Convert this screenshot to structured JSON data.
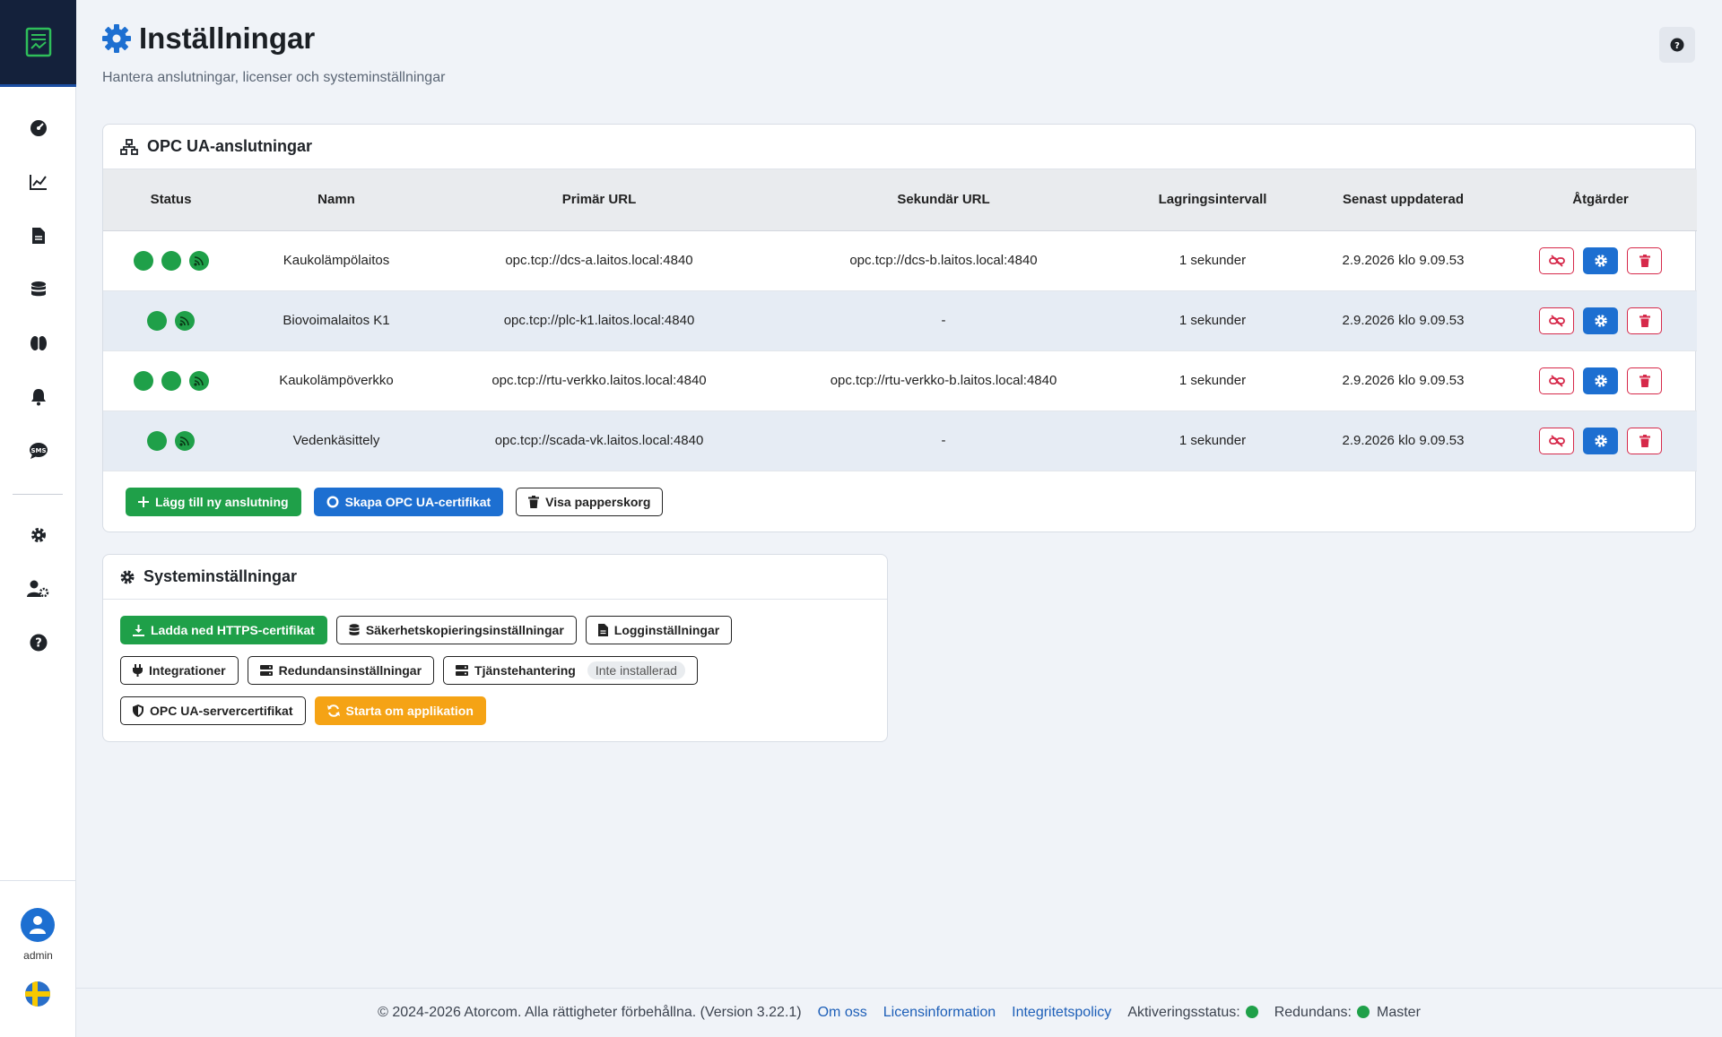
{
  "header": {
    "title": "Inställningar",
    "subtitle": "Hantera anslutningar, licenser och systeminställningar"
  },
  "sidebar": {
    "items": [
      {
        "icon": "dashboard-icon"
      },
      {
        "icon": "chart-icon"
      },
      {
        "icon": "document-icon"
      },
      {
        "icon": "database-icon"
      },
      {
        "icon": "brain-icon"
      },
      {
        "icon": "bell-icon"
      },
      {
        "icon": "sms-icon"
      },
      {
        "icon": "gear-icon"
      },
      {
        "icon": "user-settings-icon"
      },
      {
        "icon": "help-icon"
      }
    ],
    "user": "admin"
  },
  "opc": {
    "title": "OPC UA-anslutningar",
    "columns": [
      "Status",
      "Namn",
      "Primär URL",
      "Sekundär URL",
      "Lagringsintervall",
      "Senast uppdaterad",
      "Åtgärder"
    ],
    "rows": [
      {
        "status_dots": 2,
        "name": "Kaukolämpölaitos",
        "primary": "opc.tcp://dcs-a.laitos.local:4840",
        "secondary": "opc.tcp://dcs-b.laitos.local:4840",
        "interval": "1 sekunder",
        "updated": "2.9.2026 klo 9.09.53"
      },
      {
        "status_dots": 1,
        "name": "Biovoimalaitos K1",
        "primary": "opc.tcp://plc-k1.laitos.local:4840",
        "secondary": "-",
        "interval": "1 sekunder",
        "updated": "2.9.2026 klo 9.09.53"
      },
      {
        "status_dots": 2,
        "name": "Kaukolämpöverkko",
        "primary": "opc.tcp://rtu-verkko.laitos.local:4840",
        "secondary": "opc.tcp://rtu-verkko-b.laitos.local:4840",
        "interval": "1 sekunder",
        "updated": "2.9.2026 klo 9.09.53"
      },
      {
        "status_dots": 1,
        "name": "Vedenkäsittely",
        "primary": "opc.tcp://scada-vk.laitos.local:4840",
        "secondary": "-",
        "interval": "1 sekunder",
        "updated": "2.9.2026 klo 9.09.53"
      }
    ],
    "buttons": {
      "add": "Lägg till ny anslutning",
      "certificate": "Skapa OPC UA-certifikat",
      "trash": "Visa papperskorg"
    }
  },
  "system": {
    "title": "Systeminställningar",
    "buttons": {
      "https": "Ladda ned HTTPS-certifikat",
      "backup": "Säkerhetskopieringsinställningar",
      "log": "Logginställningar",
      "integrations": "Integrationer",
      "redundancy": "Redundansinställningar",
      "service": "Tjänstehantering",
      "service_badge": "Inte installerad",
      "server_cert": "OPC UA-servercertifikat",
      "restart": "Starta om applikation"
    }
  },
  "footer": {
    "copyright": "© 2024-2026 Atorcom. Alla rättigheter förbehållna. (Version 3.22.1)",
    "about": "Om oss",
    "license": "Licensinformation",
    "privacy": "Integritetspolicy",
    "activation": "Aktiveringsstatus:",
    "redundancy": "Redundans:",
    "redundancy_value": "Master"
  },
  "colors": {
    "green": "#1fa049",
    "blue": "#1d6fd1",
    "red": "#d6294a",
    "orange": "#f5a315",
    "sidebar_top": "#14213b"
  }
}
